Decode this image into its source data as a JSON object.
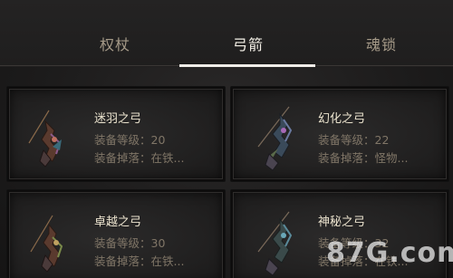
{
  "tabs": [
    {
      "label": "权杖",
      "active": false
    },
    {
      "label": "弓箭",
      "active": true
    },
    {
      "label": "魂锁",
      "active": false
    }
  ],
  "equip_level_label": "装备等级：",
  "drop_label": "装备掉落：",
  "items": [
    {
      "name": "迷羽之弓",
      "level": "20",
      "drop": "在铁..."
    },
    {
      "name": "幻化之弓",
      "level": "22",
      "drop": "怪物..."
    },
    {
      "name": "卓越之弓",
      "level": "30",
      "drop": "在铁..."
    },
    {
      "name": "神秘之弓",
      "level": "32",
      "drop": "在铁..."
    }
  ],
  "watermark": "87G.com",
  "colors": {
    "background": "#1c1b1b",
    "tab_active": "#f3efe6",
    "tab_inactive": "#a59a88",
    "item_name": "#ece4cf",
    "item_info": "#807667"
  }
}
